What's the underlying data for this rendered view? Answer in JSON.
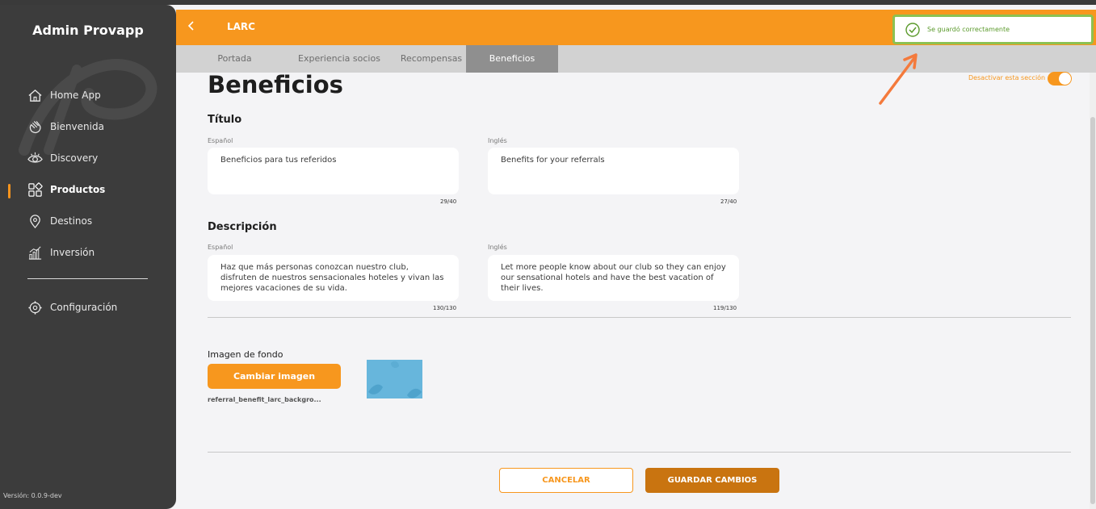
{
  "app": {
    "brand": "Admin Provapp",
    "version": "Versión: 0.0.9-dev"
  },
  "sidebar": {
    "items": [
      {
        "label": "Home App",
        "icon": "home-icon"
      },
      {
        "label": "Bienvenida",
        "icon": "wave-hand-icon"
      },
      {
        "label": "Discovery",
        "icon": "eye-icon"
      },
      {
        "label": "Productos",
        "icon": "grid-icon",
        "active": true
      },
      {
        "label": "Destinos",
        "icon": "map-pin-icon"
      },
      {
        "label": "Inversión",
        "icon": "bar-chart-icon"
      },
      {
        "label": "Configuración",
        "icon": "gear-icon"
      }
    ]
  },
  "header": {
    "title": "LARC",
    "back_icon": "chevron-left-icon"
  },
  "tabs": [
    {
      "label": "Portada"
    },
    {
      "label": "Experiencia socios"
    },
    {
      "label": "Recompensas"
    },
    {
      "label": "Beneficios",
      "active": true
    }
  ],
  "main": {
    "page_title": "Beneficios",
    "toggle_label": "Desactivar esta sección",
    "titulo": {
      "heading": "Título",
      "es_label": "Español",
      "es_value": "Beneficios para tus referidos",
      "es_count": "29/40",
      "en_label": "Inglés",
      "en_value": "Benefits for your referrals",
      "en_count": "27/40"
    },
    "descripcion": {
      "heading": "Descripción",
      "es_label": "Español",
      "es_value": "Haz que más personas conozcan nuestro club, disfruten de nuestros sensacionales hoteles y vivan las mejores vacaciones de su vida.",
      "es_count": "130/130",
      "en_label": "Inglés",
      "en_value": "Let more people know about our club so they can enjoy our sensational hotels and have the best vacation of their lives.",
      "en_count": "119/130"
    },
    "imagen": {
      "label": "Imagen de fondo",
      "button": "Cambiar imagen",
      "filename": "referral_benefit_larc_backgro..."
    },
    "actions": {
      "cancel": "CANCELAR",
      "save": "GUARDAR CAMBIOS"
    }
  },
  "toast": {
    "message": "Se guardó correctamente",
    "icon": "check-circle-icon"
  },
  "colors": {
    "accent": "#f7971e",
    "sidebar": "#3c3c3c",
    "success": "#8cc152",
    "save_button": "#c97410"
  }
}
